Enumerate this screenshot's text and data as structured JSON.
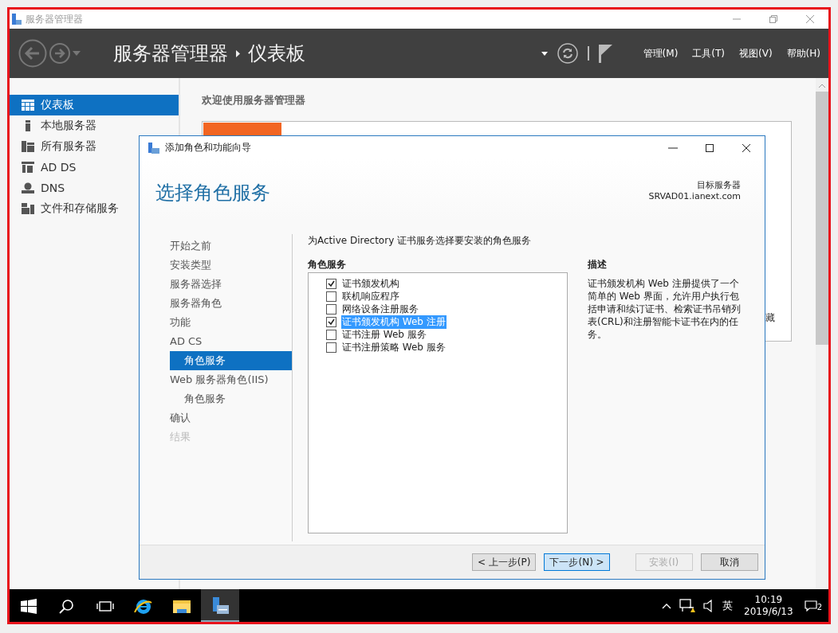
{
  "window": {
    "title": "服务器管理器"
  },
  "header": {
    "breadcrumb": [
      "服务器管理器",
      "仪表板"
    ],
    "menus": [
      "管理(M)",
      "工具(T)",
      "视图(V)",
      "帮助(H)"
    ]
  },
  "sidebar": {
    "items": [
      {
        "label": "仪表板",
        "kind": "dashboard",
        "selected": true
      },
      {
        "label": "本地服务器",
        "kind": "server",
        "selected": false
      },
      {
        "label": "所有服务器",
        "kind": "servers",
        "selected": false
      },
      {
        "label": "AD DS",
        "kind": "adds",
        "selected": false
      },
      {
        "label": "DNS",
        "kind": "dns",
        "selected": false
      },
      {
        "label": "文件和存储服务",
        "kind": "files",
        "selected": false
      }
    ]
  },
  "main": {
    "welcome": "欢迎使用服务器管理器",
    "partial_text": "藏"
  },
  "dialog": {
    "title": "添加角色和功能向导",
    "heading": "选择角色服务",
    "target_label": "目标服务器",
    "target_server": "SRVAD01.ianext.com",
    "steps": [
      {
        "label": "开始之前",
        "selected": false,
        "disabled": false
      },
      {
        "label": "安装类型",
        "selected": false,
        "disabled": false
      },
      {
        "label": "服务器选择",
        "selected": false,
        "disabled": false
      },
      {
        "label": "服务器角色",
        "selected": false,
        "disabled": false
      },
      {
        "label": "功能",
        "selected": false,
        "disabled": false
      },
      {
        "label": "AD CS",
        "selected": false,
        "disabled": false,
        "children": [
          {
            "label": "角色服务",
            "selected": true,
            "disabled": false
          }
        ]
      },
      {
        "label": "Web 服务器角色(IIS)",
        "selected": false,
        "disabled": false,
        "children": [
          {
            "label": "角色服务",
            "selected": false,
            "disabled": false
          }
        ]
      },
      {
        "label": "确认",
        "selected": false,
        "disabled": false
      },
      {
        "label": "结果",
        "selected": false,
        "disabled": true
      }
    ],
    "instruction": "为Active Directory 证书服务选择要安装的角色服务",
    "list_title": "角色服务",
    "role_services": [
      {
        "label": "证书颁发机构",
        "checked": true,
        "selected": false
      },
      {
        "label": "联机响应程序",
        "checked": false,
        "selected": false
      },
      {
        "label": "网络设备注册服务",
        "checked": false,
        "selected": false
      },
      {
        "label": "证书颁发机构 Web 注册",
        "checked": true,
        "selected": true
      },
      {
        "label": "证书注册 Web 服务",
        "checked": false,
        "selected": false
      },
      {
        "label": "证书注册策略 Web 服务",
        "checked": false,
        "selected": false
      }
    ],
    "description_title": "描述",
    "description": "证书颁发机构 Web 注册提供了一个简单的 Web 界面，允许用户执行包括申请和续订证书、检索证书吊销列表(CRL)和注册智能卡证书在内的任务。",
    "buttons": [
      {
        "label": "< 上一步(P)",
        "disabled": false,
        "highlighted": false
      },
      {
        "label": "下一步(N) >",
        "disabled": false,
        "highlighted": true
      },
      {
        "label": "安装(I)",
        "disabled": true,
        "highlighted": false
      },
      {
        "label": "取消",
        "disabled": false,
        "highlighted": false
      }
    ]
  },
  "taskbar": {
    "apps": [
      {
        "kind": "start",
        "active": false
      },
      {
        "kind": "search",
        "active": false
      },
      {
        "kind": "taskview",
        "active": false
      },
      {
        "kind": "ie",
        "active": false
      },
      {
        "kind": "explorer",
        "active": false
      },
      {
        "kind": "servermanager",
        "active": true
      }
    ],
    "ime": "英",
    "time": "10:19",
    "date": "2019/6/13",
    "notifications": "2"
  }
}
